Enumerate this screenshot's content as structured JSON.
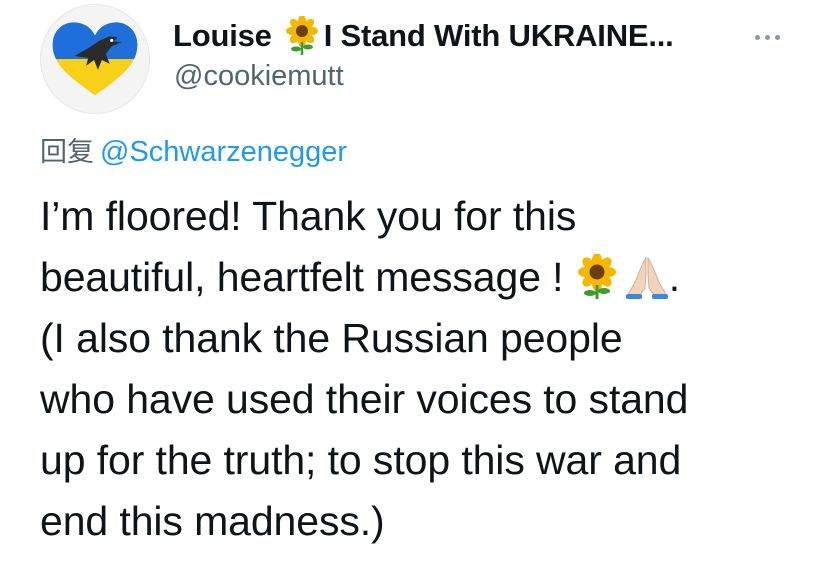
{
  "author": {
    "display_name": "Louise",
    "display_name_tail": "I Stand With UKRAINE...",
    "name_emoji": "sunflower-icon",
    "handle": "@cookiemutt",
    "avatar": "ukraine-heart-bird-avatar"
  },
  "reply": {
    "prefix": "回复",
    "mention": "@Schwarzenegger"
  },
  "tweet": {
    "line1": "I’m floored! Thank you for this",
    "line2_text": "beautiful, heartfelt message !",
    "line2_emojis": [
      "sunflower-icon",
      "folded-hands-icon"
    ],
    "line2_end": ".",
    "line3": "(I also thank the Russian people",
    "line4": "who have used their voices to stand",
    "line5": "up for the truth; to stop this war and",
    "line6": "end this madness.)"
  },
  "colors": {
    "text": "#0f1419",
    "secondary": "#536471",
    "link": "#1d9bf0",
    "ukraine_blue": "#1e6fd9",
    "ukraine_yellow": "#f7d018"
  }
}
